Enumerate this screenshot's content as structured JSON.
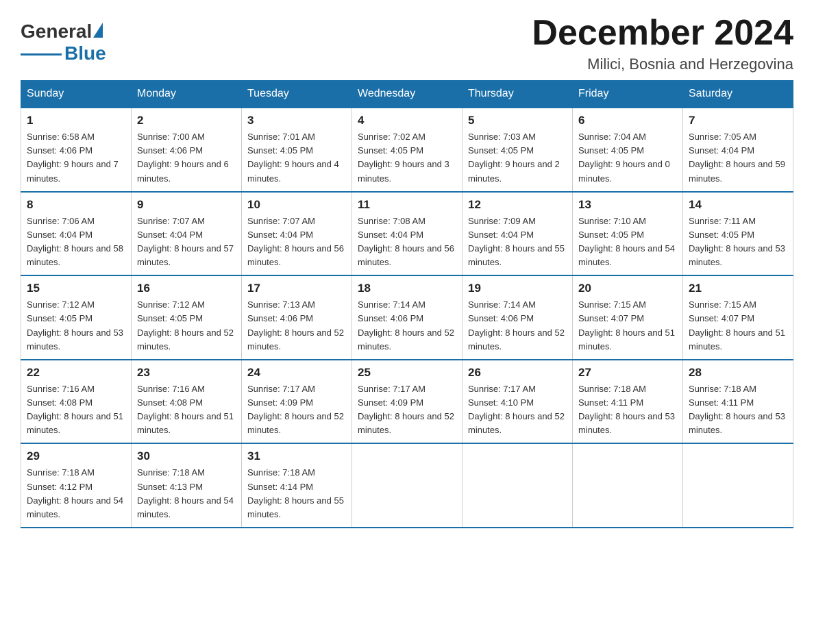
{
  "logo": {
    "general": "General",
    "blue": "Blue"
  },
  "title": {
    "month": "December 2024",
    "location": "Milici, Bosnia and Herzegovina"
  },
  "weekdays": [
    "Sunday",
    "Monday",
    "Tuesday",
    "Wednesday",
    "Thursday",
    "Friday",
    "Saturday"
  ],
  "weeks": [
    [
      {
        "day": "1",
        "sunrise": "Sunrise: 6:58 AM",
        "sunset": "Sunset: 4:06 PM",
        "daylight": "Daylight: 9 hours and 7 minutes."
      },
      {
        "day": "2",
        "sunrise": "Sunrise: 7:00 AM",
        "sunset": "Sunset: 4:06 PM",
        "daylight": "Daylight: 9 hours and 6 minutes."
      },
      {
        "day": "3",
        "sunrise": "Sunrise: 7:01 AM",
        "sunset": "Sunset: 4:05 PM",
        "daylight": "Daylight: 9 hours and 4 minutes."
      },
      {
        "day": "4",
        "sunrise": "Sunrise: 7:02 AM",
        "sunset": "Sunset: 4:05 PM",
        "daylight": "Daylight: 9 hours and 3 minutes."
      },
      {
        "day": "5",
        "sunrise": "Sunrise: 7:03 AM",
        "sunset": "Sunset: 4:05 PM",
        "daylight": "Daylight: 9 hours and 2 minutes."
      },
      {
        "day": "6",
        "sunrise": "Sunrise: 7:04 AM",
        "sunset": "Sunset: 4:05 PM",
        "daylight": "Daylight: 9 hours and 0 minutes."
      },
      {
        "day": "7",
        "sunrise": "Sunrise: 7:05 AM",
        "sunset": "Sunset: 4:04 PM",
        "daylight": "Daylight: 8 hours and 59 minutes."
      }
    ],
    [
      {
        "day": "8",
        "sunrise": "Sunrise: 7:06 AM",
        "sunset": "Sunset: 4:04 PM",
        "daylight": "Daylight: 8 hours and 58 minutes."
      },
      {
        "day": "9",
        "sunrise": "Sunrise: 7:07 AM",
        "sunset": "Sunset: 4:04 PM",
        "daylight": "Daylight: 8 hours and 57 minutes."
      },
      {
        "day": "10",
        "sunrise": "Sunrise: 7:07 AM",
        "sunset": "Sunset: 4:04 PM",
        "daylight": "Daylight: 8 hours and 56 minutes."
      },
      {
        "day": "11",
        "sunrise": "Sunrise: 7:08 AM",
        "sunset": "Sunset: 4:04 PM",
        "daylight": "Daylight: 8 hours and 56 minutes."
      },
      {
        "day": "12",
        "sunrise": "Sunrise: 7:09 AM",
        "sunset": "Sunset: 4:04 PM",
        "daylight": "Daylight: 8 hours and 55 minutes."
      },
      {
        "day": "13",
        "sunrise": "Sunrise: 7:10 AM",
        "sunset": "Sunset: 4:05 PM",
        "daylight": "Daylight: 8 hours and 54 minutes."
      },
      {
        "day": "14",
        "sunrise": "Sunrise: 7:11 AM",
        "sunset": "Sunset: 4:05 PM",
        "daylight": "Daylight: 8 hours and 53 minutes."
      }
    ],
    [
      {
        "day": "15",
        "sunrise": "Sunrise: 7:12 AM",
        "sunset": "Sunset: 4:05 PM",
        "daylight": "Daylight: 8 hours and 53 minutes."
      },
      {
        "day": "16",
        "sunrise": "Sunrise: 7:12 AM",
        "sunset": "Sunset: 4:05 PM",
        "daylight": "Daylight: 8 hours and 52 minutes."
      },
      {
        "day": "17",
        "sunrise": "Sunrise: 7:13 AM",
        "sunset": "Sunset: 4:06 PM",
        "daylight": "Daylight: 8 hours and 52 minutes."
      },
      {
        "day": "18",
        "sunrise": "Sunrise: 7:14 AM",
        "sunset": "Sunset: 4:06 PM",
        "daylight": "Daylight: 8 hours and 52 minutes."
      },
      {
        "day": "19",
        "sunrise": "Sunrise: 7:14 AM",
        "sunset": "Sunset: 4:06 PM",
        "daylight": "Daylight: 8 hours and 52 minutes."
      },
      {
        "day": "20",
        "sunrise": "Sunrise: 7:15 AM",
        "sunset": "Sunset: 4:07 PM",
        "daylight": "Daylight: 8 hours and 51 minutes."
      },
      {
        "day": "21",
        "sunrise": "Sunrise: 7:15 AM",
        "sunset": "Sunset: 4:07 PM",
        "daylight": "Daylight: 8 hours and 51 minutes."
      }
    ],
    [
      {
        "day": "22",
        "sunrise": "Sunrise: 7:16 AM",
        "sunset": "Sunset: 4:08 PM",
        "daylight": "Daylight: 8 hours and 51 minutes."
      },
      {
        "day": "23",
        "sunrise": "Sunrise: 7:16 AM",
        "sunset": "Sunset: 4:08 PM",
        "daylight": "Daylight: 8 hours and 51 minutes."
      },
      {
        "day": "24",
        "sunrise": "Sunrise: 7:17 AM",
        "sunset": "Sunset: 4:09 PM",
        "daylight": "Daylight: 8 hours and 52 minutes."
      },
      {
        "day": "25",
        "sunrise": "Sunrise: 7:17 AM",
        "sunset": "Sunset: 4:09 PM",
        "daylight": "Daylight: 8 hours and 52 minutes."
      },
      {
        "day": "26",
        "sunrise": "Sunrise: 7:17 AM",
        "sunset": "Sunset: 4:10 PM",
        "daylight": "Daylight: 8 hours and 52 minutes."
      },
      {
        "day": "27",
        "sunrise": "Sunrise: 7:18 AM",
        "sunset": "Sunset: 4:11 PM",
        "daylight": "Daylight: 8 hours and 53 minutes."
      },
      {
        "day": "28",
        "sunrise": "Sunrise: 7:18 AM",
        "sunset": "Sunset: 4:11 PM",
        "daylight": "Daylight: 8 hours and 53 minutes."
      }
    ],
    [
      {
        "day": "29",
        "sunrise": "Sunrise: 7:18 AM",
        "sunset": "Sunset: 4:12 PM",
        "daylight": "Daylight: 8 hours and 54 minutes."
      },
      {
        "day": "30",
        "sunrise": "Sunrise: 7:18 AM",
        "sunset": "Sunset: 4:13 PM",
        "daylight": "Daylight: 8 hours and 54 minutes."
      },
      {
        "day": "31",
        "sunrise": "Sunrise: 7:18 AM",
        "sunset": "Sunset: 4:14 PM",
        "daylight": "Daylight: 8 hours and 55 minutes."
      },
      null,
      null,
      null,
      null
    ]
  ]
}
